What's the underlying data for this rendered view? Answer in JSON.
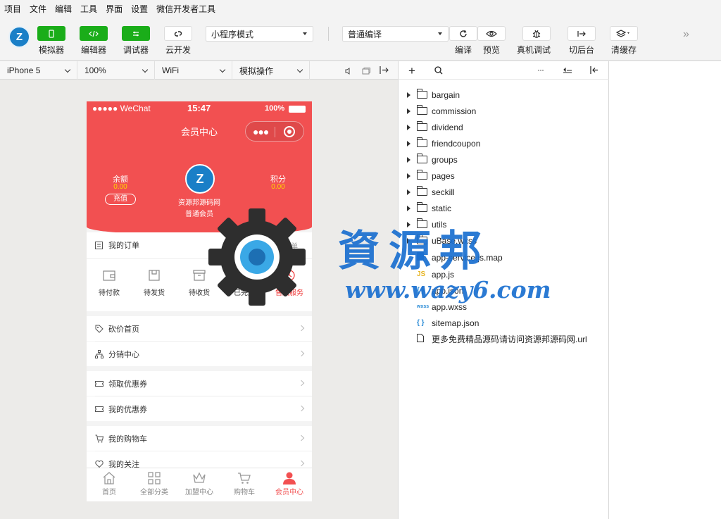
{
  "menubar": [
    "项目",
    "文件",
    "编辑",
    "工具",
    "界面",
    "设置",
    "微信开发者工具"
  ],
  "toolbar": {
    "simulator": "模拟器",
    "editor": "编辑器",
    "debugger": "调试器",
    "cloud": "云开发",
    "mode_select": "小程序模式",
    "compile_select": "普通编译",
    "compile": "编译",
    "preview": "预览",
    "remote_debug": "真机调试",
    "backend": "切后台",
    "clear_cache": "清缓存",
    "accent": "#1aad19"
  },
  "devbar": {
    "device": "iPhone 5",
    "zoom": "100%",
    "network": "WiFi",
    "operation": "模拟操作"
  },
  "phone": {
    "status": {
      "carrier": "●●●●● WeChat",
      "time": "15:47",
      "battery": "100%"
    },
    "nav_title": "会员中心",
    "balance_label": "余额",
    "balance_value": "0.00",
    "recharge": "充值",
    "points_label": "积分",
    "points_value": "0.00",
    "username": "资源邦源码网",
    "level": "普通会员",
    "orders_title": "我的订单",
    "orders_all": "全部订单",
    "order_items": [
      "待付款",
      "待发货",
      "待收货",
      "已完成",
      "售后服务"
    ],
    "menu_group1": [
      "砍价首页",
      "分销中心"
    ],
    "menu_group2": [
      "领取优惠券",
      "我的优惠券"
    ],
    "menu_group3": [
      "我的购物车",
      "我的关注"
    ],
    "tabs": [
      "首页",
      "全部分类",
      "加盟中心",
      "购物车",
      "会员中心"
    ],
    "header_color": "#f25051",
    "highlight_color": "#ffd500"
  },
  "files": {
    "folders": [
      "bargain",
      "commission",
      "dividend",
      "friendcoupon",
      "groups",
      "pages",
      "seckill",
      "static",
      "utils",
      "uBase.wxss"
    ],
    "items": [
      {
        "icon": "",
        "name": "app-service.js.map"
      },
      {
        "icon": "JS",
        "name": "app.js"
      },
      {
        "icon": "{ }",
        "name": "app.json"
      },
      {
        "icon": "wxss",
        "name": "app.wxss"
      },
      {
        "icon": "{ }",
        "name": "sitemap.json"
      },
      {
        "icon": "",
        "name": "更多免费精品源码请访问资源邦源码网.url"
      }
    ]
  },
  "watermark": {
    "text": "資源邦",
    "url": "www.wazy6.com",
    "color": "#1a6fd0"
  }
}
